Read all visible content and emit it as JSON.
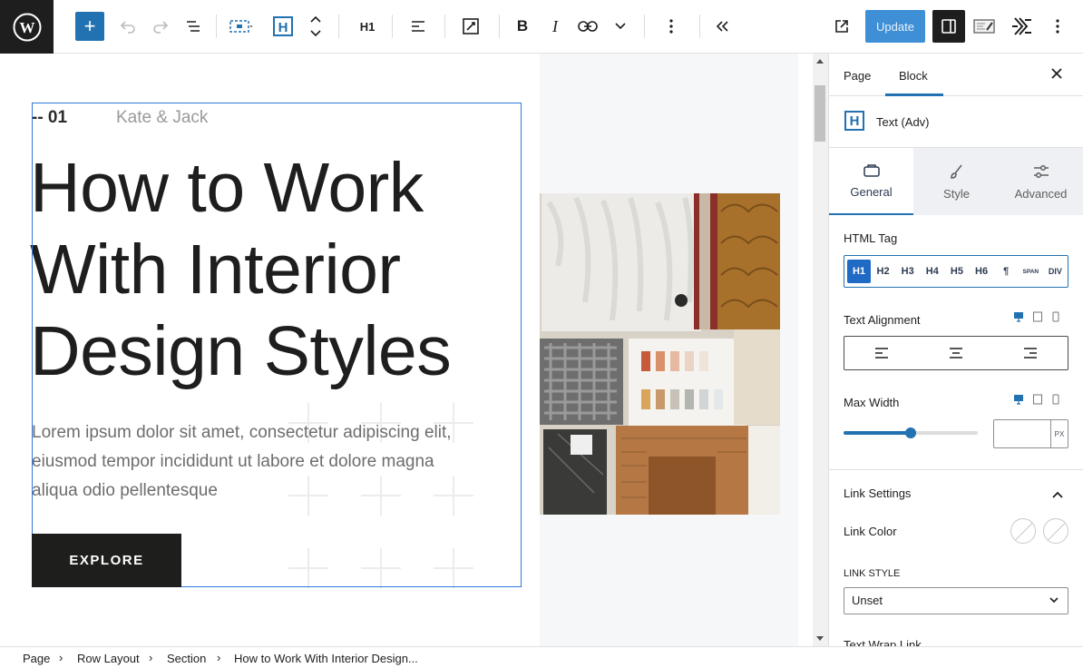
{
  "toolbar": {
    "add_label": "+",
    "heading_level": "H1",
    "update_label": "Update"
  },
  "canvas": {
    "eyebrow_number": "-- 01",
    "eyebrow_author": "Kate & Jack",
    "heading_lines": [
      "How to Work",
      "With Interior",
      "Design Styles"
    ],
    "paragraph_lines": [
      "Lorem ipsum dolor sit amet, consectetur adipiscing elit,",
      "eiusmod tempor incididunt ut labore et dolore magna",
      "aliqua odio pellentesque"
    ],
    "button_label": "EXPLORE"
  },
  "panel": {
    "tabs": [
      {
        "label": "Page"
      },
      {
        "label": "Block"
      }
    ],
    "active_tab": "Block",
    "close_icon": "close-icon",
    "block_name": "Text (Adv)",
    "block_icon_letter": "H",
    "settings_tabs": [
      {
        "label": "General",
        "icon": "card-icon"
      },
      {
        "label": "Style",
        "icon": "brush-icon"
      },
      {
        "label": "Advanced",
        "icon": "sliders-icon"
      }
    ],
    "active_settings_tab": "General",
    "html_tag_label": "HTML Tag",
    "html_tags": [
      "H1",
      "H2",
      "H3",
      "H4",
      "H5",
      "H6",
      "¶",
      "SPAN",
      "DIV"
    ],
    "active_html_tag": "H1",
    "text_alignment_label": "Text Alignment",
    "max_width_label": "Max Width",
    "max_width_slider_fraction": 0.5,
    "max_width_unit": "PX",
    "max_width_value": "",
    "link_settings_label": "Link Settings",
    "link_color_label": "Link Color",
    "link_style_label": "LINK STYLE",
    "link_style_value": "Unset",
    "text_wrap_link_label": "Text Wrap Link"
  },
  "breadcrumb": [
    "Page",
    "Row Layout",
    "Section",
    "How to Work With Interior Design..."
  ],
  "colors": {
    "accent": "#2271b1",
    "update_button": "#3f8fd6",
    "button_dark": "#1e1f1d"
  }
}
